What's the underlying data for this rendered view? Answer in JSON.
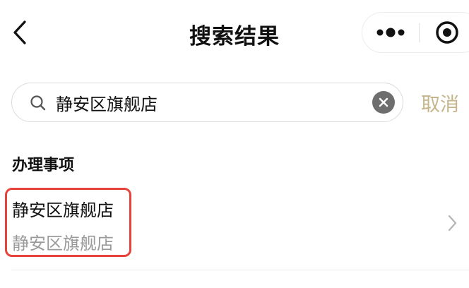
{
  "nav": {
    "title": "搜索结果"
  },
  "search": {
    "value": "静安区旗舰店",
    "cancel_label": "取消"
  },
  "section": {
    "title": "办理事项"
  },
  "results": [
    {
      "title": "静安区旗舰店",
      "subtitle": "静安区旗舰店"
    }
  ],
  "colors": {
    "accent_cancel": "#c6b58a",
    "highlight_border": "#e8423c",
    "subtitle_gray": "#9a9a9a"
  },
  "icons": {
    "back": "back-arrow-icon",
    "more": "more-dots-icon",
    "close": "capsule-close-icon",
    "search": "search-icon",
    "clear": "clear-icon",
    "chevron": "chevron-right-icon"
  }
}
